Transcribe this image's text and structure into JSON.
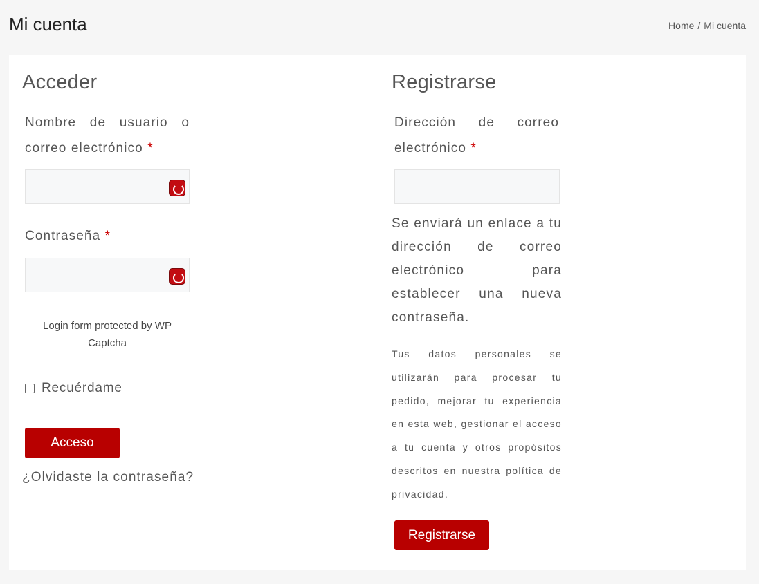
{
  "page": {
    "title": "Mi cuenta",
    "breadcrumb": {
      "home": "Home",
      "separator": "/",
      "current": "Mi cuenta"
    }
  },
  "login": {
    "heading": "Acceder",
    "username_label": "Nombre de usuario o correo electrónico",
    "username_value": "",
    "password_label": "Contraseña",
    "password_value": "",
    "required_mark": "*",
    "captcha_note": "Login form protected by WP Captcha",
    "remember_label": "Recuérdame",
    "remember_checked": false,
    "submit_label": "Acceso",
    "lost_password": "¿Olvidaste la contraseña?"
  },
  "register": {
    "heading": "Registrarse",
    "email_label": "Dirección de correo electrónico",
    "email_value": "",
    "required_mark": "*",
    "password_info": "Se enviará un enlace a tu dirección de correo electrónico para establecer una nueva contraseña.",
    "privacy_text": "Tus datos personales se utilizarán para procesar tu pedido, mejorar tu experiencia en esta web, gestionar el acceso a tu cuenta y otros propósitos descritos en nuestra política de privacidad.",
    "submit_label": "Registrarse"
  },
  "icons": {
    "input_field_icon": "captcha-shield-icon"
  },
  "colors": {
    "accent": "#b80000",
    "required": "#cc0000",
    "background": "#f6f6f6",
    "card": "#ffffff"
  }
}
